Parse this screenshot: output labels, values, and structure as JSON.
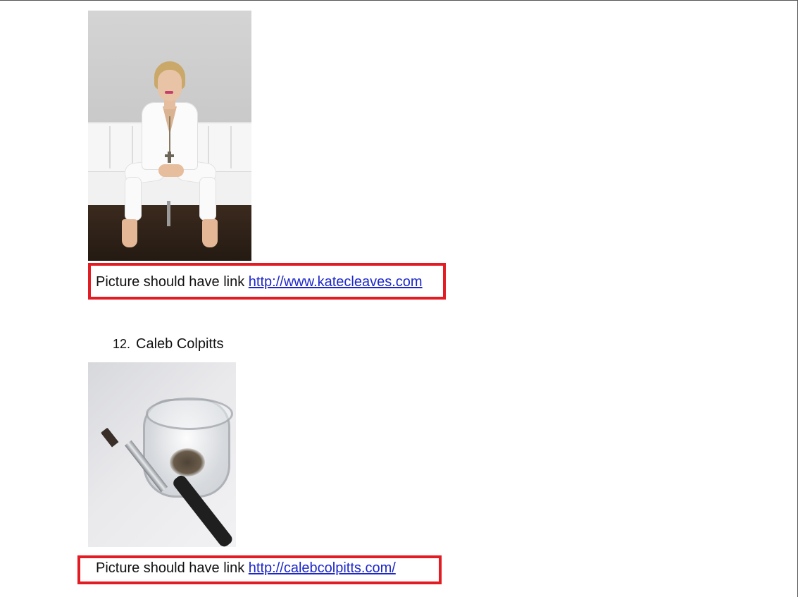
{
  "items": [
    {
      "caption_prefix": "Picture should have link",
      "link_text": "http://www.katecleaves.com"
    },
    {
      "number": "12.",
      "name": "Caleb Colpitts",
      "caption_prefix": "Picture should have link",
      "link_text": "http://calebcolpitts.com/"
    }
  ],
  "colors": {
    "highlight": "#e31b23",
    "link": "#1d27c9"
  }
}
